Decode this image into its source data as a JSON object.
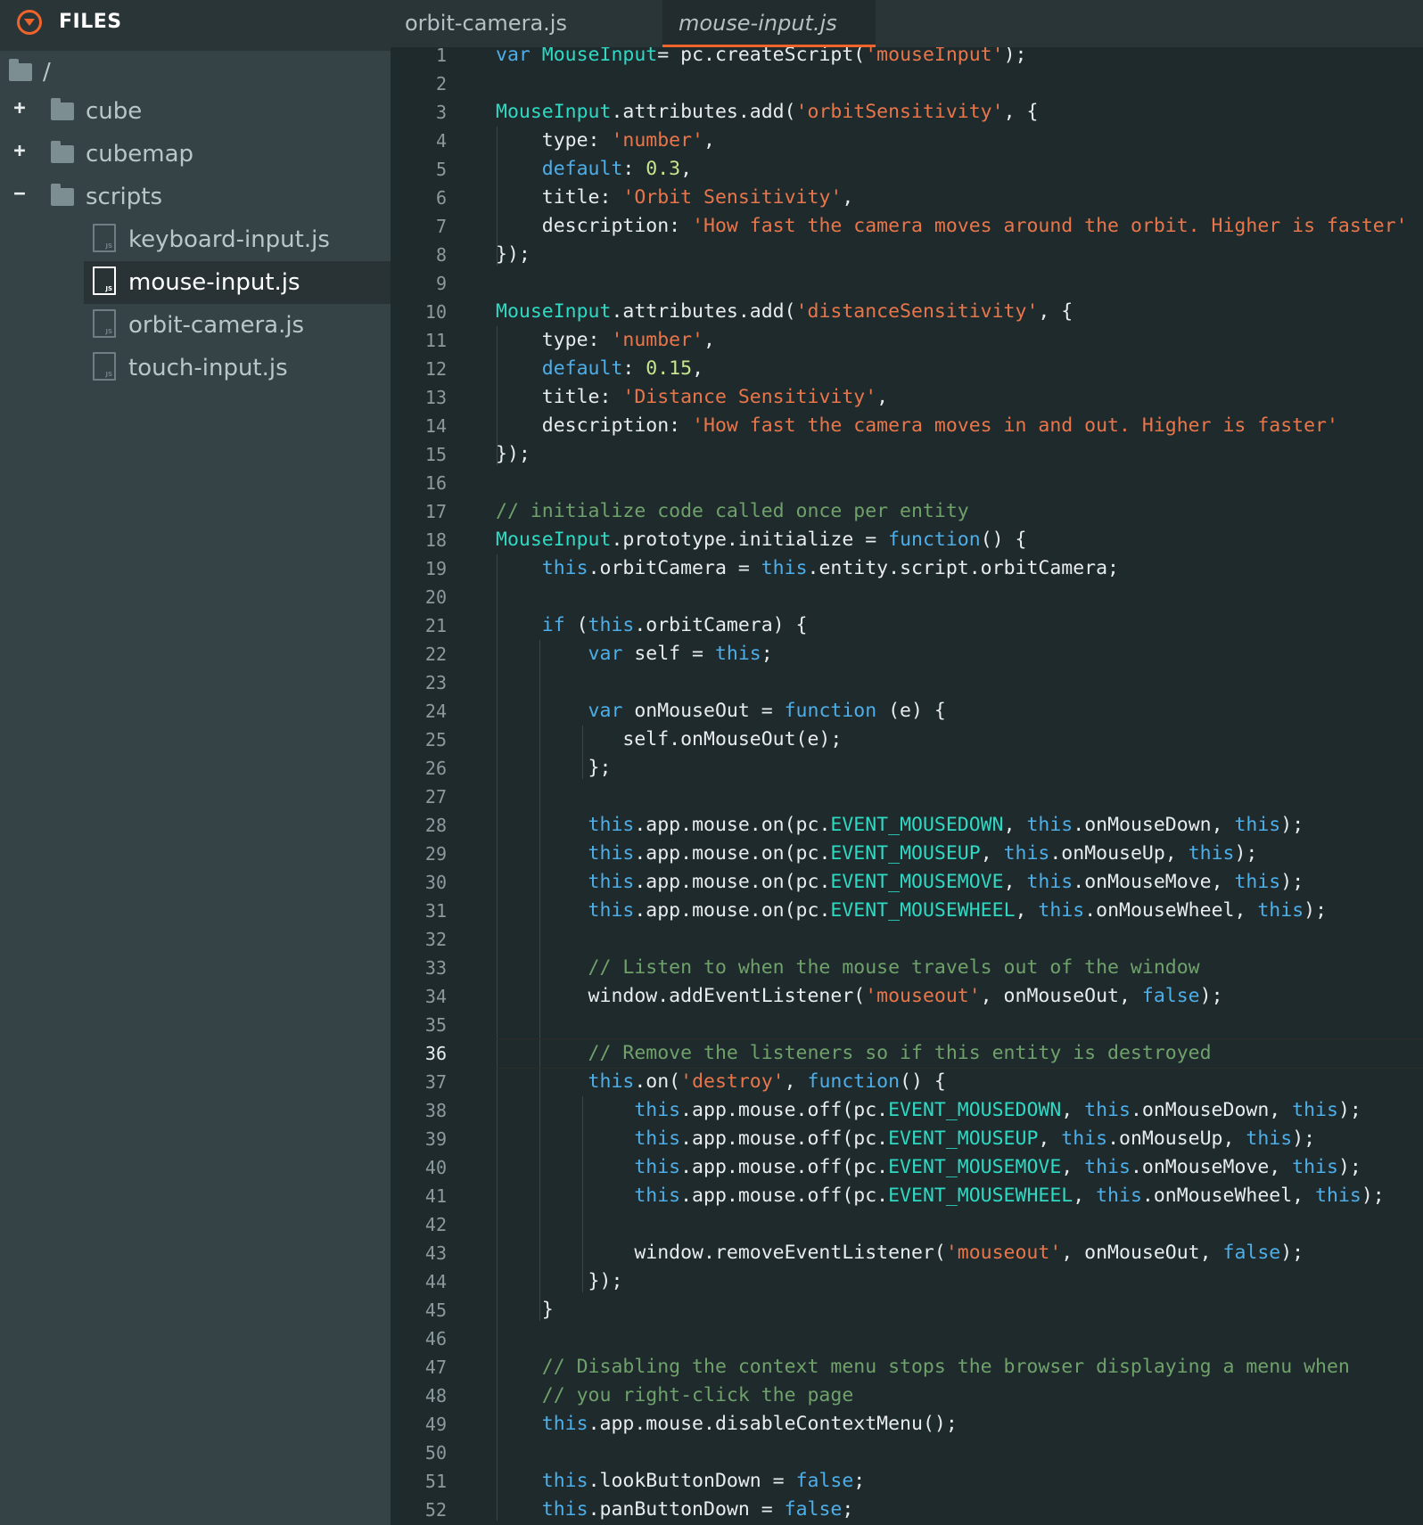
{
  "sidebar": {
    "title": "FILES",
    "root_label": "/",
    "items": [
      {
        "label": "cube",
        "expander": "+"
      },
      {
        "label": "cubemap",
        "expander": "+"
      },
      {
        "label": "scripts",
        "expander": "−"
      },
      {
        "label": "keyboard-input.js"
      },
      {
        "label": "mouse-input.js"
      },
      {
        "label": "orbit-camera.js"
      },
      {
        "label": "touch-input.js"
      }
    ]
  },
  "tabs": [
    {
      "label": "orbit-camera.js"
    },
    {
      "label": "mouse-input.js",
      "active": true
    }
  ],
  "editor": {
    "current_line": 36,
    "line_numbers": [
      "1",
      "2",
      "3",
      "4",
      "5",
      "6",
      "7",
      "8",
      "9",
      "10",
      "11",
      "12",
      "13",
      "14",
      "15",
      "16",
      "17",
      "18",
      "19",
      "20",
      "21",
      "22",
      "23",
      "24",
      "25",
      "26",
      "27",
      "28",
      "29",
      "30",
      "31",
      "32",
      "33",
      "34",
      "35",
      "36",
      "37",
      "38",
      "39",
      "40",
      "41",
      "42",
      "43",
      "44",
      "45",
      "46",
      "47",
      "48",
      "49",
      "50",
      "51",
      "52"
    ],
    "lines": [
      [
        [
          "kw",
          "var "
        ],
        [
          "cls",
          "MouseInput"
        ],
        [
          "",
          "= pc.createScript("
        ],
        [
          "str",
          "'mouseInput'"
        ],
        [
          "",
          ");"
        ]
      ],
      [],
      [
        [
          "cls",
          "MouseInput"
        ],
        [
          "",
          ".attributes.add("
        ],
        [
          "str",
          "'orbitSensitivity'"
        ],
        [
          "",
          ", {"
        ]
      ],
      [
        [
          "",
          "    type: "
        ],
        [
          "str",
          "'number'"
        ],
        [
          "",
          ","
        ]
      ],
      [
        [
          "kw",
          "    default"
        ],
        [
          "",
          ": "
        ],
        [
          "num",
          "0.3"
        ],
        [
          "",
          ","
        ]
      ],
      [
        [
          "",
          "    title: "
        ],
        [
          "str",
          "'Orbit Sensitivity'"
        ],
        [
          "",
          ","
        ]
      ],
      [
        [
          "",
          "    description: "
        ],
        [
          "str",
          "'How fast the camera moves around the orbit. Higher is faster'"
        ]
      ],
      [
        [
          "",
          "});"
        ]
      ],
      [],
      [
        [
          "cls",
          "MouseInput"
        ],
        [
          "",
          ".attributes.add("
        ],
        [
          "str",
          "'distanceSensitivity'"
        ],
        [
          "",
          ", {"
        ]
      ],
      [
        [
          "",
          "    type: "
        ],
        [
          "str",
          "'number'"
        ],
        [
          "",
          ","
        ]
      ],
      [
        [
          "kw",
          "    default"
        ],
        [
          "",
          ": "
        ],
        [
          "num",
          "0.15"
        ],
        [
          "",
          ","
        ]
      ],
      [
        [
          "",
          "    title: "
        ],
        [
          "str",
          "'Distance Sensitivity'"
        ],
        [
          "",
          ","
        ]
      ],
      [
        [
          "",
          "    description: "
        ],
        [
          "str",
          "'How fast the camera moves in and out. Higher is faster'"
        ]
      ],
      [
        [
          "",
          "});"
        ]
      ],
      [],
      [
        [
          "cmt",
          "// initialize code called once per entity"
        ]
      ],
      [
        [
          "cls",
          "MouseInput"
        ],
        [
          "",
          ".prototype.initialize = "
        ],
        [
          "kw",
          "function"
        ],
        [
          "",
          "() {"
        ]
      ],
      [
        [
          "kw",
          "    this"
        ],
        [
          "",
          ".orbitCamera = "
        ],
        [
          "kw",
          "this"
        ],
        [
          "",
          ".entity.script.orbitCamera;"
        ]
      ],
      [],
      [
        [
          "kw",
          "    if"
        ],
        [
          "",
          " ("
        ],
        [
          "kw",
          "this"
        ],
        [
          "",
          ".orbitCamera) {"
        ]
      ],
      [
        [
          "kw",
          "        var"
        ],
        [
          "",
          " self = "
        ],
        [
          "kw",
          "this"
        ],
        [
          "",
          ";"
        ]
      ],
      [],
      [
        [
          "kw",
          "        var"
        ],
        [
          "",
          " onMouseOut = "
        ],
        [
          "kw",
          "function"
        ],
        [
          "",
          " (e) {"
        ]
      ],
      [
        [
          "",
          "           self.onMouseOut(e);"
        ]
      ],
      [
        [
          "",
          "        };"
        ]
      ],
      [],
      [
        [
          "kw",
          "        this"
        ],
        [
          "",
          ".app.mouse.on(pc."
        ],
        [
          "cst",
          "EVENT_MOUSEDOWN"
        ],
        [
          "",
          ", "
        ],
        [
          "kw",
          "this"
        ],
        [
          "",
          ".onMouseDown, "
        ],
        [
          "kw",
          "this"
        ],
        [
          "",
          ");"
        ]
      ],
      [
        [
          "kw",
          "        this"
        ],
        [
          "",
          ".app.mouse.on(pc."
        ],
        [
          "cst",
          "EVENT_MOUSEUP"
        ],
        [
          "",
          ", "
        ],
        [
          "kw",
          "this"
        ],
        [
          "",
          ".onMouseUp, "
        ],
        [
          "kw",
          "this"
        ],
        [
          "",
          ");"
        ]
      ],
      [
        [
          "kw",
          "        this"
        ],
        [
          "",
          ".app.mouse.on(pc."
        ],
        [
          "cst",
          "EVENT_MOUSEMOVE"
        ],
        [
          "",
          ", "
        ],
        [
          "kw",
          "this"
        ],
        [
          "",
          ".onMouseMove, "
        ],
        [
          "kw",
          "this"
        ],
        [
          "",
          ");"
        ]
      ],
      [
        [
          "kw",
          "        this"
        ],
        [
          "",
          ".app.mouse.on(pc."
        ],
        [
          "cst",
          "EVENT_MOUSEWHEEL"
        ],
        [
          "",
          ", "
        ],
        [
          "kw",
          "this"
        ],
        [
          "",
          ".onMouseWheel, "
        ],
        [
          "kw",
          "this"
        ],
        [
          "",
          ");"
        ]
      ],
      [],
      [
        [
          "cmt",
          "        // Listen to when the mouse travels out of the window"
        ]
      ],
      [
        [
          "",
          "        window.addEventListener("
        ],
        [
          "str",
          "'mouseout'"
        ],
        [
          "",
          ", onMouseOut, "
        ],
        [
          "kw",
          "false"
        ],
        [
          "",
          ");"
        ]
      ],
      [],
      [
        [
          "cmt",
          "        // Remove the listeners so if this entity is destroyed"
        ]
      ],
      [
        [
          "kw",
          "        this"
        ],
        [
          "",
          ".on("
        ],
        [
          "str",
          "'destroy'"
        ],
        [
          "",
          ", "
        ],
        [
          "kw",
          "function"
        ],
        [
          "",
          "() {"
        ]
      ],
      [
        [
          "kw",
          "            this"
        ],
        [
          "",
          ".app.mouse.off(pc."
        ],
        [
          "cst",
          "EVENT_MOUSEDOWN"
        ],
        [
          "",
          ", "
        ],
        [
          "kw",
          "this"
        ],
        [
          "",
          ".onMouseDown, "
        ],
        [
          "kw",
          "this"
        ],
        [
          "",
          ");"
        ]
      ],
      [
        [
          "kw",
          "            this"
        ],
        [
          "",
          ".app.mouse.off(pc."
        ],
        [
          "cst",
          "EVENT_MOUSEUP"
        ],
        [
          "",
          ", "
        ],
        [
          "kw",
          "this"
        ],
        [
          "",
          ".onMouseUp, "
        ],
        [
          "kw",
          "this"
        ],
        [
          "",
          ");"
        ]
      ],
      [
        [
          "kw",
          "            this"
        ],
        [
          "",
          ".app.mouse.off(pc."
        ],
        [
          "cst",
          "EVENT_MOUSEMOVE"
        ],
        [
          "",
          ", "
        ],
        [
          "kw",
          "this"
        ],
        [
          "",
          ".onMouseMove, "
        ],
        [
          "kw",
          "this"
        ],
        [
          "",
          ");"
        ]
      ],
      [
        [
          "kw",
          "            this"
        ],
        [
          "",
          ".app.mouse.off(pc."
        ],
        [
          "cst",
          "EVENT_MOUSEWHEEL"
        ],
        [
          "",
          ", "
        ],
        [
          "kw",
          "this"
        ],
        [
          "",
          ".onMouseWheel, "
        ],
        [
          "kw",
          "this"
        ],
        [
          "",
          ");"
        ]
      ],
      [],
      [
        [
          "",
          "            window.removeEventListener("
        ],
        [
          "str",
          "'mouseout'"
        ],
        [
          "",
          ", onMouseOut, "
        ],
        [
          "kw",
          "false"
        ],
        [
          "",
          ");"
        ]
      ],
      [
        [
          "",
          "        });"
        ]
      ],
      [
        [
          "",
          "    }"
        ]
      ],
      [],
      [
        [
          "cmt",
          "    // Disabling the context menu stops the browser displaying a menu when"
        ]
      ],
      [
        [
          "cmt",
          "    // you right-click the page"
        ]
      ],
      [
        [
          "kw",
          "    this"
        ],
        [
          "",
          ".app.mouse.disableContextMenu();"
        ]
      ],
      [],
      [
        [
          "kw",
          "    this"
        ],
        [
          "",
          ".lookButtonDown = "
        ],
        [
          "kw",
          "false"
        ],
        [
          "",
          ";"
        ]
      ],
      [
        [
          "kw",
          "    this"
        ],
        [
          "",
          ".panButtonDown = "
        ],
        [
          "kw",
          "false"
        ],
        [
          "",
          ";"
        ]
      ]
    ]
  }
}
